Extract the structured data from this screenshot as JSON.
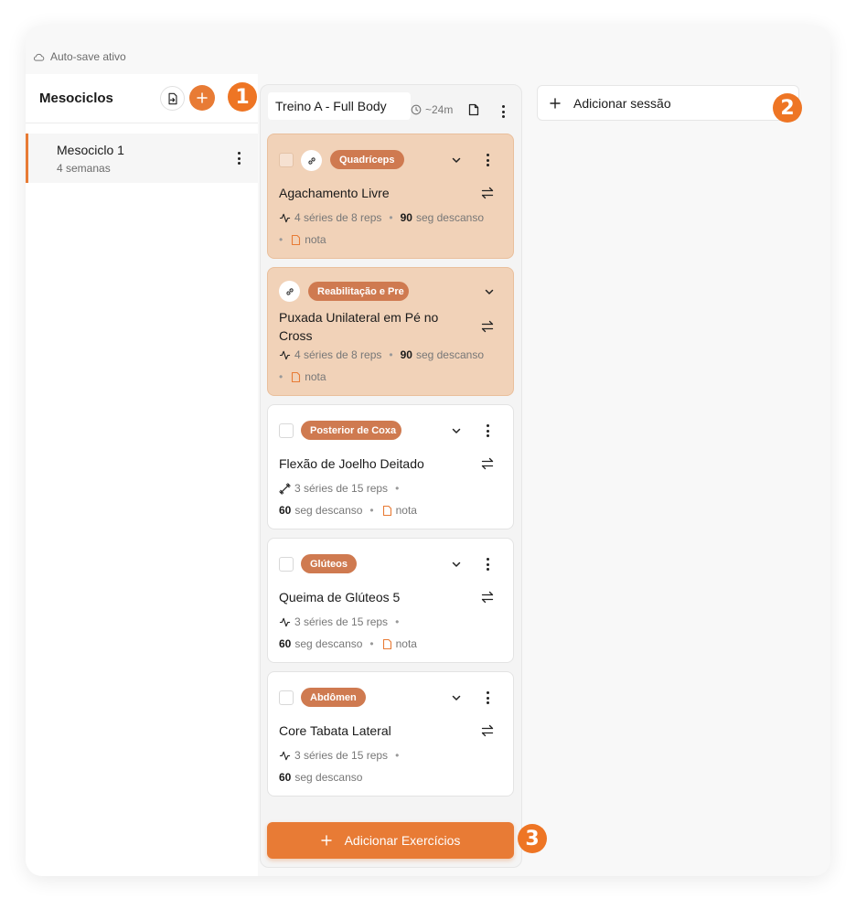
{
  "app": {
    "autosave_label": "Auto-save ativo"
  },
  "sidebar": {
    "title": "Mesociclos",
    "items": [
      {
        "name": "Mesociclo 1",
        "subtitle": "4 semanas"
      }
    ]
  },
  "badges": {
    "b1": "1",
    "b2": "2",
    "b3": "3"
  },
  "session": {
    "title": "Treino A - Full Body",
    "duration": "~24m",
    "exercises": [
      {
        "tag": "Quadríceps",
        "name": "Agachamento Livre",
        "sets": "4 séries de 8 reps",
        "rest_value": "90",
        "rest_unit": "seg descanso",
        "note": "nota"
      },
      {
        "tag": "Reabilitação e Pre",
        "name": "Puxada Unilateral em Pé no Cross",
        "sets": "4 séries de 8 reps",
        "rest_value": "90",
        "rest_unit": "seg descanso",
        "note": "nota"
      },
      {
        "tag": "Posterior de Coxa",
        "name": "Flexão de Joelho Deitado",
        "sets": "3 séries de 15 reps",
        "rest_value": "60",
        "rest_unit": "seg descanso",
        "note": "nota"
      },
      {
        "tag": "Glúteos",
        "name": "Queima de Glúteos 5",
        "sets": "3 séries de 15 reps",
        "rest_value": "60",
        "rest_unit": "seg descanso",
        "note": "nota"
      },
      {
        "tag": "Abdômen",
        "name": "Core Tabata Lateral",
        "sets": "3 séries de 15 reps",
        "rest_value": "60",
        "rest_unit": "seg descanso"
      }
    ],
    "add_exercises_label": "Adicionar Exercícios"
  },
  "add_session_label": "Adicionar sessão",
  "colors": {
    "accent": "#e87b35",
    "tag": "#cf7a50",
    "selected_card": "#f1d2b8"
  }
}
